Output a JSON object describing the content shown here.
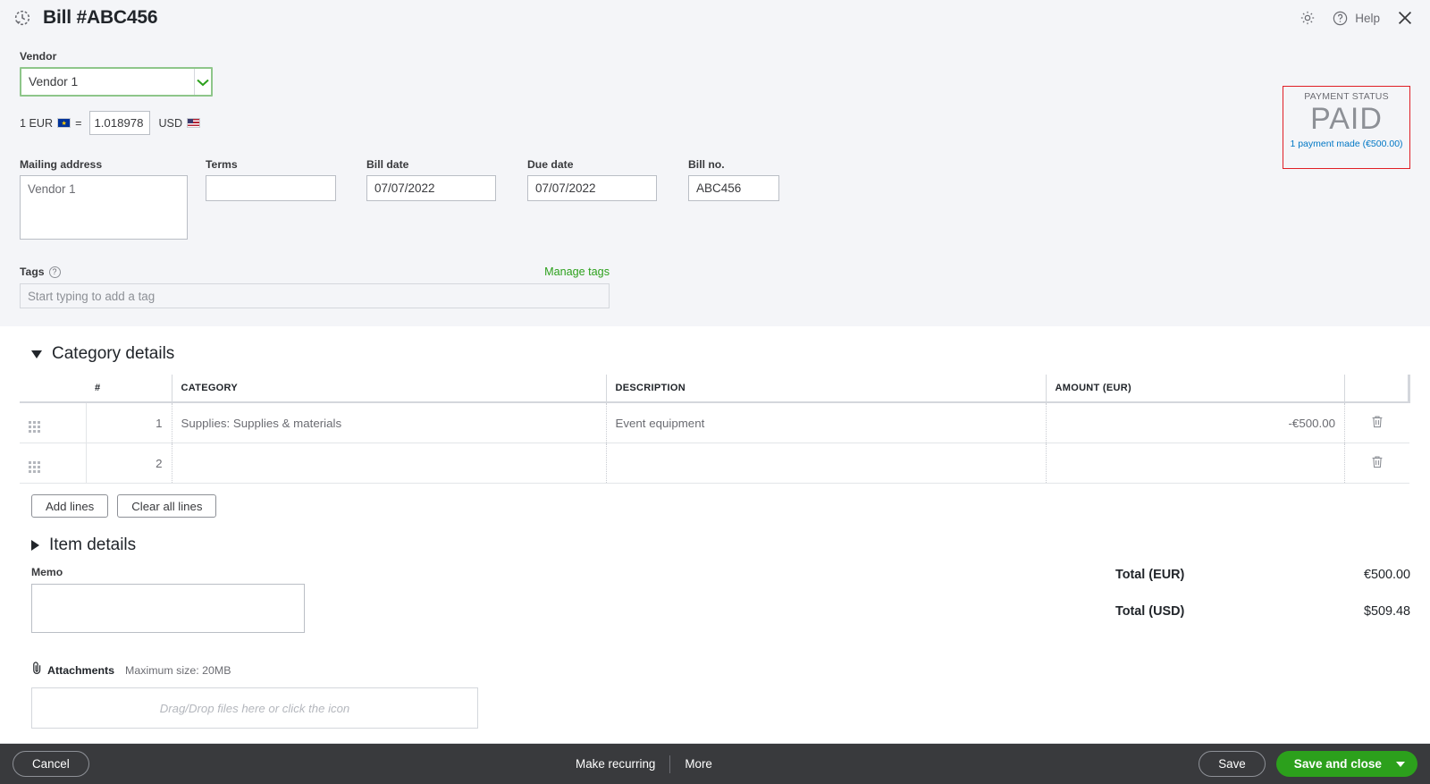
{
  "header": {
    "title": "Bill #ABC456",
    "history_icon": "history-clock-icon",
    "gear_icon": "gear-icon",
    "help_icon": "question-circle-icon",
    "help_label": "Help",
    "close_icon": "close-x-icon"
  },
  "vendor": {
    "label": "Vendor",
    "value": "Vendor 1",
    "placeholder": "",
    "dropdown_icon": "chevron-down-icon",
    "focus_color": "#8ec68a"
  },
  "exchange": {
    "prefix": "1 EUR",
    "from_flag": "eu-flag-icon",
    "equals": "=",
    "rate": "1.018978",
    "suffix": "USD",
    "to_flag": "us-flag-icon"
  },
  "mailing": {
    "label": "Mailing address",
    "value": "Vendor 1"
  },
  "terms": {
    "label": "Terms",
    "value": "",
    "dropdown_icon": "caret-down-icon"
  },
  "bill_date": {
    "label": "Bill date",
    "value": "07/07/2022"
  },
  "due_date": {
    "label": "Due date",
    "value": "07/07/2022"
  },
  "bill_no": {
    "label": "Bill no.",
    "value": "ABC456"
  },
  "tags": {
    "label": "Tags",
    "help_icon": "question-mark-icon",
    "manage_link": "Manage tags",
    "placeholder": "Start typing to add a tag",
    "value": ""
  },
  "payment_status": {
    "label": "PAYMENT STATUS",
    "value": "PAID",
    "link": "1 payment made (€500.00)",
    "border_color": "#e01e25",
    "link_color": "#0077c5"
  },
  "category_details": {
    "title": "Category details",
    "expanded": true,
    "toggle_icon": "triangle-down-icon",
    "columns": [
      "",
      "#",
      "CATEGORY",
      "DESCRIPTION",
      "AMOUNT (EUR)",
      ""
    ],
    "rows": [
      {
        "drag_icon": "drag-handle-icon",
        "num": "1",
        "category": "Supplies: Supplies & materials",
        "description": "Event equipment",
        "amount": "-€500.00",
        "delete_icon": "trash-icon"
      },
      {
        "drag_icon": "drag-handle-icon",
        "num": "2",
        "category": "",
        "description": "",
        "amount": "",
        "delete_icon": "trash-icon"
      }
    ],
    "add_lines_label": "Add lines",
    "clear_lines_label": "Clear all lines"
  },
  "item_details": {
    "title": "Item details",
    "expanded": false,
    "toggle_icon": "triangle-right-icon"
  },
  "memo": {
    "label": "Memo",
    "value": ""
  },
  "totals": [
    {
      "label": "Total (EUR)",
      "value": "€500.00"
    },
    {
      "label": "Total (USD)",
      "value": "$509.48"
    }
  ],
  "attachments": {
    "icon": "paperclip-icon",
    "title": "Attachments",
    "max_size": "Maximum size: 20MB",
    "dropzone_text": "Drag/Drop files here or click the icon"
  },
  "footer": {
    "cancel": "Cancel",
    "make_recurring": "Make recurring",
    "more": "More",
    "save": "Save",
    "save_and_close": "Save and close",
    "save_dropdown_icon": "caret-down-icon",
    "accent_color": "#2ca01c",
    "bar_color": "#393a3d"
  }
}
